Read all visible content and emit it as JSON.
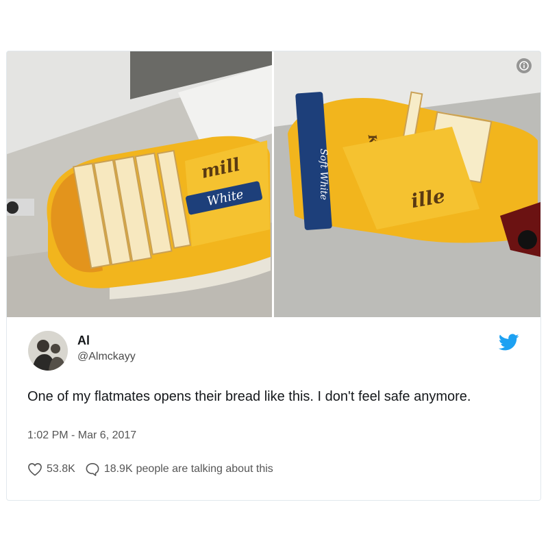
{
  "tweet": {
    "display_name": "Al",
    "handle": "@Almckayy",
    "text": "One of my flatmates opens their bread like this. I don't feel safe anymore.",
    "timestamp": "1:02 PM - Mar 6, 2017",
    "like_count": "53.8K",
    "talk_count": "18.9K",
    "talk_suffix": "people are talking about this"
  },
  "media": {
    "photo_left_labels": [
      "mill",
      "White"
    ],
    "photo_right_labels": [
      "Kingsmill",
      "Soft White",
      "ille"
    ],
    "info_icon": "info-icon"
  },
  "icons": {
    "brand": "twitter-bird-icon",
    "like": "heart-icon",
    "reply": "speech-bubble-icon",
    "info": "info-icon"
  },
  "colors": {
    "twitter_blue": "#1da1f2",
    "text": "#14171a",
    "muted": "#555555",
    "border": "#e1e8ed",
    "bag_yellow": "#f2b51d"
  }
}
